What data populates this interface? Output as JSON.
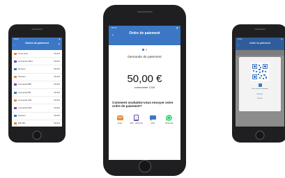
{
  "left": {
    "status_time": "16:40",
    "title": "Ordres de paiement",
    "subtitle": "",
    "items": [
      {
        "name": "Trevor Dove",
        "meta": "",
        "amount": "50,00 €",
        "color": "#e8893a"
      },
      {
        "name": "commande 12543",
        "meta": "",
        "amount": "50,00 €",
        "color": "#6b4ea8"
      },
      {
        "name": "Nouveau",
        "meta": "",
        "amount": "50,00 €",
        "color": "#3b77c4"
      },
      {
        "name": "Nouveau",
        "meta": "",
        "amount": "50,00 €",
        "color": "#e8893a"
      },
      {
        "name": "commande 5887",
        "meta": "",
        "amount": "50,00 €",
        "color": "#6b4ea8"
      },
      {
        "name": "commande 258",
        "meta": "",
        "amount": "50,00 €",
        "color": "#3b77c4"
      },
      {
        "name": "commande 1254",
        "meta": "",
        "amount": "50,00 €",
        "color": "#e8893a"
      },
      {
        "name": "commande 2354",
        "meta": "",
        "amount": "50,00 €",
        "color": "#6b4ea8"
      },
      {
        "name": "Nouveau",
        "meta": "",
        "amount": "50,00 €",
        "color": "#3b77c4"
      },
      {
        "name": "BNC 897",
        "meta": "",
        "amount": "50,00 €",
        "color": "#e8893a"
      }
    ]
  },
  "center": {
    "status_time": "15:47",
    "title": "Ordre de paiement",
    "subtitle": "",
    "request_label": "Demande de paiement",
    "amount": "50,00 €",
    "order_label": "commande 1244",
    "question": "Comment souhaitez-vous envoyer votre ordre de paiement?",
    "options": [
      {
        "label": "Email",
        "icon": "email-icon",
        "color": "#e8893a"
      },
      {
        "label": "SMS - SMS plus",
        "icon": "sms-plus-icon",
        "color": "#6b4ea8"
      },
      {
        "label": "SMS",
        "icon": "sms-icon",
        "color": "#3b77c4"
      },
      {
        "label": "WhatsApp",
        "icon": "whatsapp-icon",
        "color": "#25d366"
      }
    ],
    "accent": "#3b77c4"
  },
  "right": {
    "status_time": "16:40",
    "title": "Ordre de paiement",
    "qr_description": "Votre ordre de paiement",
    "send_label": "Envoyer",
    "close_label": "Fermer"
  }
}
